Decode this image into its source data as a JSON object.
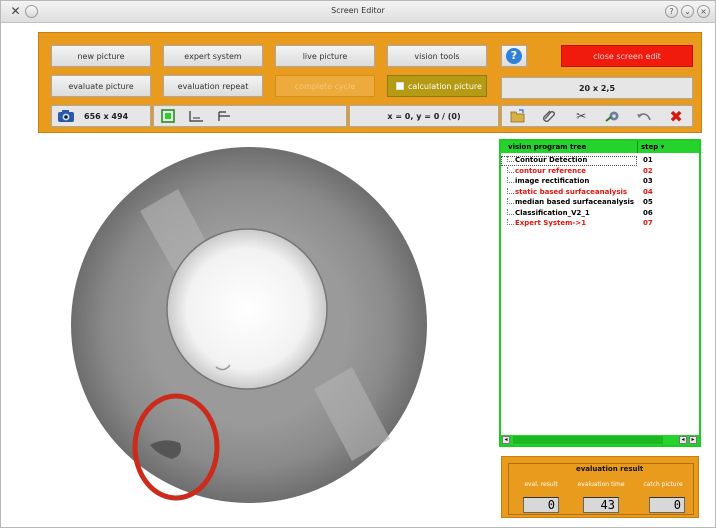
{
  "window": {
    "title": "Screen Editor"
  },
  "toolbar": {
    "new_picture": "new picture",
    "expert_system": "expert system",
    "live_picture": "live picture",
    "vision_tools": "vision tools",
    "close_screen_edit": "close screen edit",
    "evaluate_picture": "evaluate picture",
    "evaluation_repeat": "evaluation repeat",
    "complete_cycle": "complete cycle",
    "calculation_picture": "calculation picture",
    "scale": "20 x 2,5",
    "resolution": "656 x 494",
    "coordinates": "x = 0, y = 0 / (0)"
  },
  "tree": {
    "col_name": "vision program tree",
    "col_step": "step",
    "items": [
      {
        "name": "Contour Detection",
        "step": "01",
        "color": "#000000"
      },
      {
        "name": "contour reference",
        "step": "02",
        "color": "#e8150e"
      },
      {
        "name": "image rectification",
        "step": "03",
        "color": "#000000"
      },
      {
        "name": "static based surfaceanalysis",
        "step": "04",
        "color": "#e8150e"
      },
      {
        "name": "median based surfaceanalysis",
        "step": "05",
        "color": "#000000"
      },
      {
        "name": "Classification_V2_1",
        "step": "06",
        "color": "#000000"
      },
      {
        "name": "Expert System->1",
        "step": "07",
        "color": "#e8150e"
      }
    ]
  },
  "evaluation": {
    "title": "evaluation result",
    "eval_result_label": "eval. result",
    "eval_time_label": "evaluation time",
    "catch_label": "catch picture",
    "eval_result": "0",
    "eval_time": "43",
    "catch_picture": "0"
  },
  "colors": {
    "accent": "#e89b1c",
    "tree_green": "#26d32c",
    "close_red": "#f01a0d",
    "marker_red": "#cc2a1a"
  }
}
